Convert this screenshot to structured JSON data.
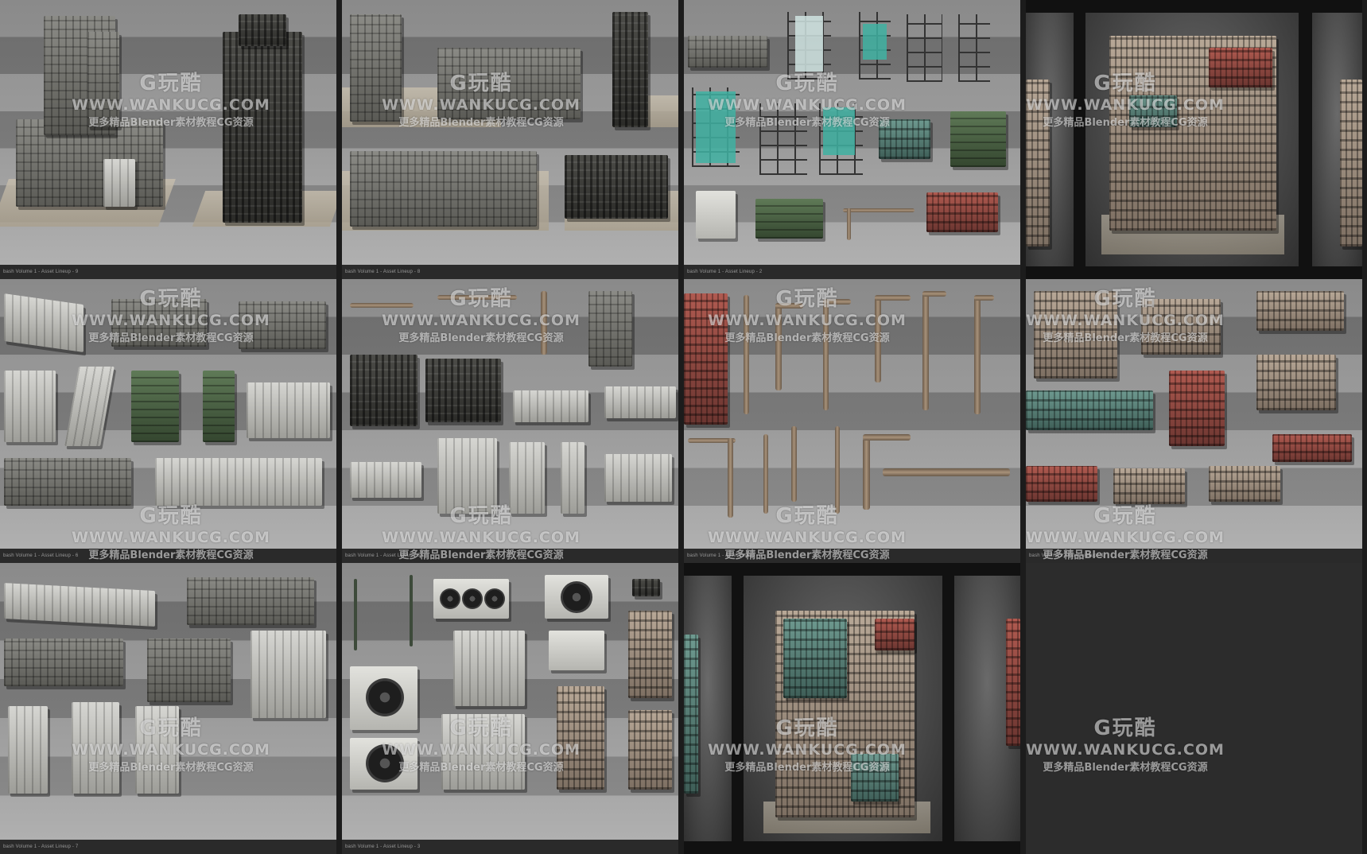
{
  "watermark": {
    "logo": "G玩酷",
    "url": "WWW.WANKUCG.COM",
    "sub": "更多精品Blender素材教程CG资源"
  },
  "captions": {
    "c1": "bash Volume 1 - Asset Lineup - 9",
    "c2": "bash Volume 1 - Asset Lineup - 8",
    "c3": "bash Volume 1 - Asset Lineup - 2",
    "c5": "bash Volume 1 - Asset Lineup - 6",
    "c6": "bash Volume 1 - Asset Lineup - 5",
    "c7": "bash Volume 1 - Asset Lineup - 4",
    "c8": "bash Volume 1 - Asset Lineup - 1",
    "c9": "bash Volume 1 - Asset Lineup - 7",
    "c10": "bash Volume 1 - Asset Lineup - 3"
  },
  "colors": {
    "background": "#262626",
    "stripe_light": "#9c9c9c",
    "stripe_dark": "#727272",
    "watermark": "#ffffff"
  }
}
